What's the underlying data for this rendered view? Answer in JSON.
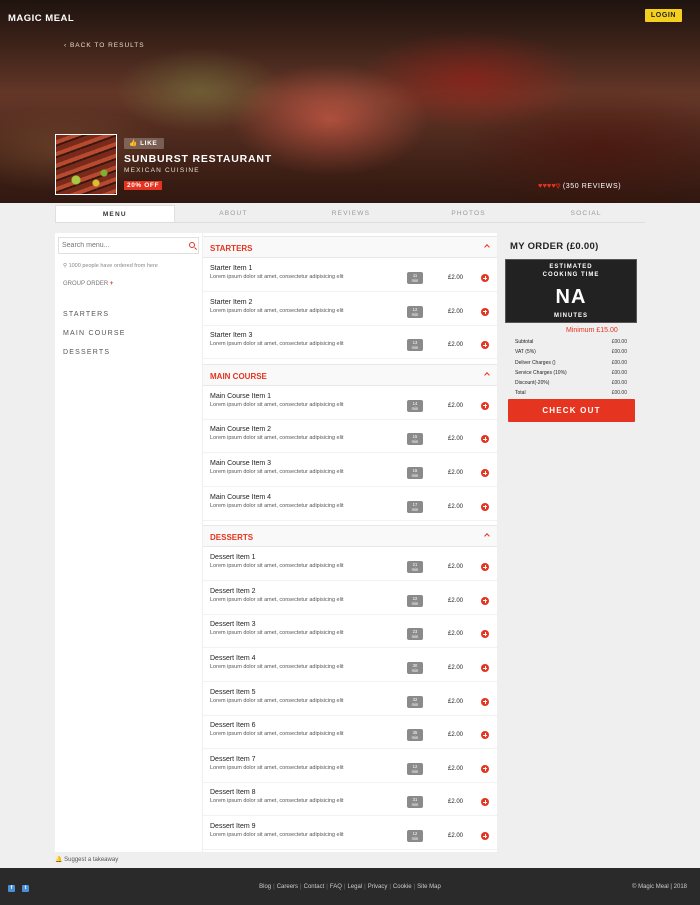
{
  "header": {
    "brand": "MAGIC MEAL",
    "login_label": "LOGIN",
    "back_label": "‹ BACK TO RESULTS"
  },
  "restaurant": {
    "like_label": "👍 LIKE",
    "name": "SUNBURST RESTAURANT",
    "cuisine": "MEXICAN CUISINE",
    "offer": "20% OFF",
    "rating_hearts": 4,
    "rating_max": 5,
    "reviews": "(350 REVIEWS)"
  },
  "tabs": [
    {
      "label": "MENU",
      "active": true
    },
    {
      "label": "ABOUT",
      "active": false
    },
    {
      "label": "REVIEWS",
      "active": false
    },
    {
      "label": "PHOTOS",
      "active": false
    },
    {
      "label": "SOCIAL",
      "active": false
    }
  ],
  "sidebar": {
    "search_placeholder": "Search menu...",
    "ordered_text": "1000 people have ordered from here",
    "group_order": "GROUP ORDER",
    "categories": [
      "STARTERS",
      "MAIN COURSE",
      "DESSERTS"
    ]
  },
  "menu": {
    "sections": [
      {
        "title": "STARTERS",
        "items": [
          {
            "name": "Starter Item 1",
            "desc": "Lorem ipsum dolor sit amet, consectetur adipisicing elit",
            "time": "11",
            "unit": "min",
            "price": "£2.00"
          },
          {
            "name": "Starter Item 2",
            "desc": "Lorem ipsum dolor sit amet, consectetur adipisicing elit",
            "time": "12",
            "unit": "min",
            "price": "£2.00"
          },
          {
            "name": "Starter Item 3",
            "desc": "Lorem ipsum dolor sit amet, consectetur adipisicing elit",
            "time": "13",
            "unit": "min",
            "price": "£2.00"
          }
        ]
      },
      {
        "title": "MAIN COURSE",
        "items": [
          {
            "name": "Main Course Item 1",
            "desc": "Lorem ipsum dolor sit amet, consectetur adipisicing elit",
            "time": "14",
            "unit": "min",
            "price": "£2.00"
          },
          {
            "name": "Main Course Item 2",
            "desc": "Lorem ipsum dolor sit amet, consectetur adipisicing elit",
            "time": "15",
            "unit": "min",
            "price": "£2.00"
          },
          {
            "name": "Main Course Item 3",
            "desc": "Lorem ipsum dolor sit amet, consectetur adipisicing elit",
            "time": "16",
            "unit": "min",
            "price": "£2.00"
          },
          {
            "name": "Main Course Item 4",
            "desc": "Lorem ipsum dolor sit amet, consectetur adipisicing elit",
            "time": "17",
            "unit": "min",
            "price": "£2.00"
          }
        ]
      },
      {
        "title": "DESSERTS",
        "items": [
          {
            "name": "Dessert Item 1",
            "desc": "Lorem ipsum dolor sit amet, consectetur adipisicing elit",
            "time": "21",
            "unit": "min",
            "price": "£2.00"
          },
          {
            "name": "Dessert Item 2",
            "desc": "Lorem ipsum dolor sit amet, consectetur adipisicing elit",
            "time": "22",
            "unit": "min",
            "price": "£2.00"
          },
          {
            "name": "Dessert Item 3",
            "desc": "Lorem ipsum dolor sit amet, consectetur adipisicing elit",
            "time": "23",
            "unit": "min",
            "price": "£2.00"
          },
          {
            "name": "Dessert Item 4",
            "desc": "Lorem ipsum dolor sit amet, consectetur adipisicing elit",
            "time": "30",
            "unit": "min",
            "price": "£2.00"
          },
          {
            "name": "Dessert Item 5",
            "desc": "Lorem ipsum dolor sit amet, consectetur adipisicing elit",
            "time": "32",
            "unit": "min",
            "price": "£2.00"
          },
          {
            "name": "Dessert Item 6",
            "desc": "Lorem ipsum dolor sit amet, consectetur adipisicing elit",
            "time": "35",
            "unit": "min",
            "price": "£2.00"
          },
          {
            "name": "Dessert Item 7",
            "desc": "Lorem ipsum dolor sit amet, consectetur adipisicing elit",
            "time": "12",
            "unit": "min",
            "price": "£2.00"
          },
          {
            "name": "Dessert Item 8",
            "desc": "Lorem ipsum dolor sit amet, consectetur adipisicing elit",
            "time": "31",
            "unit": "min",
            "price": "£2.00"
          },
          {
            "name": "Dessert Item 9",
            "desc": "Lorem ipsum dolor sit amet, consectetur adipisicing elit",
            "time": "12",
            "unit": "min",
            "price": "£2.00"
          }
        ]
      }
    ]
  },
  "order": {
    "title": "MY ORDER (£0.00)",
    "estimated_label": "ESTIMATED",
    "cooking_label": "COOKING TIME",
    "value": "NA",
    "minutes_label": "MINUTES",
    "minimum": "Minimum £15.00",
    "summary": [
      {
        "label": "Subtotal",
        "value": "£00.00"
      },
      {
        "label": "VAT (5%)",
        "value": "£00.00"
      },
      {
        "label": "Deliver Charges ()",
        "value": "£00.00"
      },
      {
        "label": "Service Charges (10%)",
        "value": "£00.00"
      },
      {
        "label": "Discount(-20%)",
        "value": "£00.00"
      },
      {
        "label": "Total",
        "value": "£00.00"
      }
    ],
    "checkout_label": "CHECK OUT"
  },
  "suggest": "Suggest a takeaway",
  "footer": {
    "links": [
      "Blog",
      "Careers",
      "Contact",
      "FAQ",
      "Legal",
      "Privacy",
      "Cookie",
      "Site Map"
    ],
    "copyright": "© Magic Meal | 2018"
  },
  "colors": {
    "accent": "#e5341f",
    "login": "#f5cf1e",
    "footer": "#2a2a2a"
  }
}
